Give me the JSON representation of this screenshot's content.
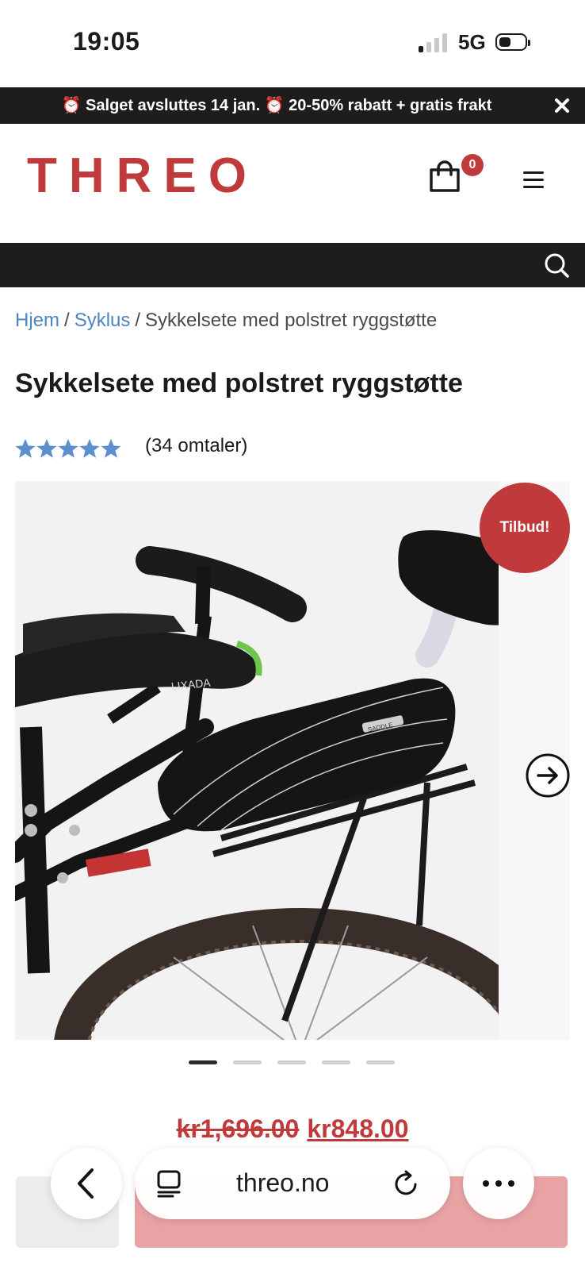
{
  "status_bar": {
    "time": "19:05",
    "network": "5G"
  },
  "promo": {
    "text": "⏰ Salget avsluttes 14 jan. ⏰ 20-50% rabatt + gratis frakt",
    "close": "✕"
  },
  "header": {
    "logo": "THREO",
    "cart_count": "0"
  },
  "breadcrumb": {
    "home": "Hjem",
    "category": "Syklus",
    "current": "Sykkelsete med polstret ryggstøtte",
    "separator": "/"
  },
  "product": {
    "title": "Sykkelsete med polstret ryggstøtte",
    "rating": 5,
    "reviews": "(34 omtaler)",
    "sale_badge": "Tilbud!",
    "image_labels": {
      "brand": "LIXADA",
      "seat": "SADDLE"
    },
    "gallery": {
      "total": 5,
      "active": 1
    },
    "old_price": "kr1,696.00",
    "new_price": "kr848.00"
  },
  "browser": {
    "url": "threo.no"
  },
  "colors": {
    "brand": "#c0393b",
    "link": "#4b86c3",
    "star": "#5b8fcf",
    "dark": "#1d1d1d"
  }
}
